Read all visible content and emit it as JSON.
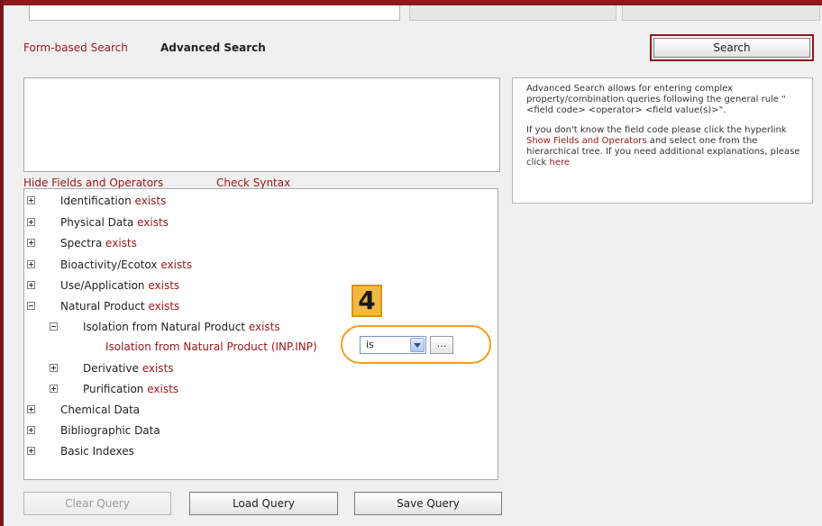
{
  "header": {
    "tab_form_based": "Form-based Search",
    "tab_advanced": "Advanced Search",
    "search_label": "Search"
  },
  "query": {
    "value": ""
  },
  "help": {
    "paragraph1": "Advanced Search allows for entering complex property/combination queries following the general rule \"<field code> <operator> <field value(s)>\".",
    "p2_before": "If you don't know the field code please click the hyperlink ",
    "p2_link1": "Show Fields and Operators",
    "p2_middle": " and select one from the hierarchical tree. If you need additional explanations, please click ",
    "p2_link2": "here"
  },
  "links": {
    "hide_fields": "Hide Fields and Operators",
    "check_syntax": "Check Syntax"
  },
  "tree": {
    "exists_word": "exists",
    "items": [
      {
        "label": "Identification",
        "state": "collapsed"
      },
      {
        "label": "Physical Data",
        "state": "collapsed"
      },
      {
        "label": "Spectra",
        "state": "collapsed"
      },
      {
        "label": "Bioactivity/Ecotox",
        "state": "collapsed"
      },
      {
        "label": "Use/Application",
        "state": "collapsed"
      },
      {
        "label": "Natural Product",
        "state": "expanded"
      },
      {
        "label": "Isolation from Natural Product",
        "state": "expanded"
      },
      {
        "label": "Isolation from Natural Product (INP.INP)",
        "state": "leaf"
      },
      {
        "label": "Derivative",
        "state": "collapsed"
      },
      {
        "label": "Purification",
        "state": "collapsed"
      },
      {
        "label": "Chemical Data",
        "state": "collapsed"
      },
      {
        "label": "Bibliographic Data",
        "state": "collapsed"
      },
      {
        "label": "Basic Indexes",
        "state": "collapsed"
      }
    ]
  },
  "operator": {
    "selected": "is",
    "more_label": "..."
  },
  "annotation": {
    "step": "4",
    "color": "#f0a020"
  },
  "buttons": {
    "clear": "Clear Query",
    "load": "Load Query",
    "save": "Save Query"
  },
  "colors": {
    "accent": "#a01818",
    "frame": "#8c1a1a"
  }
}
